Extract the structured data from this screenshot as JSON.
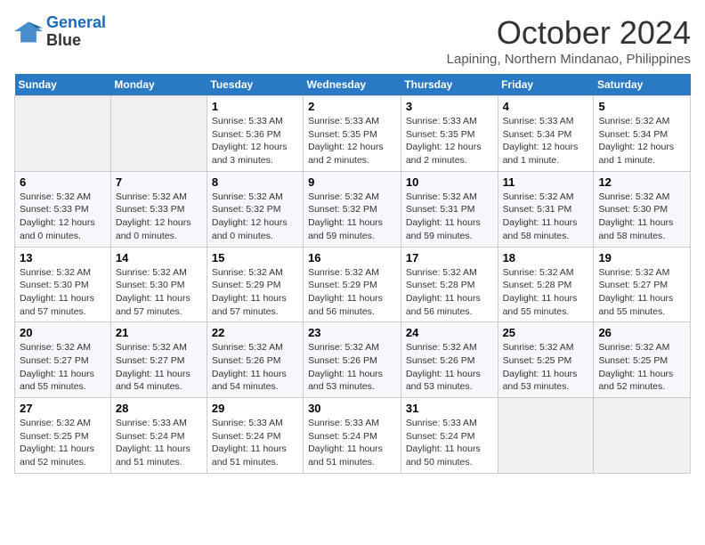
{
  "logo": {
    "line1": "General",
    "line2": "Blue"
  },
  "title": "October 2024",
  "location": "Lapining, Northern Mindanao, Philippines",
  "days_of_week": [
    "Sunday",
    "Monday",
    "Tuesday",
    "Wednesday",
    "Thursday",
    "Friday",
    "Saturday"
  ],
  "weeks": [
    [
      {
        "day": "",
        "detail": ""
      },
      {
        "day": "",
        "detail": ""
      },
      {
        "day": "1",
        "detail": "Sunrise: 5:33 AM\nSunset: 5:36 PM\nDaylight: 12 hours\nand 3 minutes."
      },
      {
        "day": "2",
        "detail": "Sunrise: 5:33 AM\nSunset: 5:35 PM\nDaylight: 12 hours\nand 2 minutes."
      },
      {
        "day": "3",
        "detail": "Sunrise: 5:33 AM\nSunset: 5:35 PM\nDaylight: 12 hours\nand 2 minutes."
      },
      {
        "day": "4",
        "detail": "Sunrise: 5:33 AM\nSunset: 5:34 PM\nDaylight: 12 hours\nand 1 minute."
      },
      {
        "day": "5",
        "detail": "Sunrise: 5:32 AM\nSunset: 5:34 PM\nDaylight: 12 hours\nand 1 minute."
      }
    ],
    [
      {
        "day": "6",
        "detail": "Sunrise: 5:32 AM\nSunset: 5:33 PM\nDaylight: 12 hours\nand 0 minutes."
      },
      {
        "day": "7",
        "detail": "Sunrise: 5:32 AM\nSunset: 5:33 PM\nDaylight: 12 hours\nand 0 minutes."
      },
      {
        "day": "8",
        "detail": "Sunrise: 5:32 AM\nSunset: 5:32 PM\nDaylight: 12 hours\nand 0 minutes."
      },
      {
        "day": "9",
        "detail": "Sunrise: 5:32 AM\nSunset: 5:32 PM\nDaylight: 11 hours\nand 59 minutes."
      },
      {
        "day": "10",
        "detail": "Sunrise: 5:32 AM\nSunset: 5:31 PM\nDaylight: 11 hours\nand 59 minutes."
      },
      {
        "day": "11",
        "detail": "Sunrise: 5:32 AM\nSunset: 5:31 PM\nDaylight: 11 hours\nand 58 minutes."
      },
      {
        "day": "12",
        "detail": "Sunrise: 5:32 AM\nSunset: 5:30 PM\nDaylight: 11 hours\nand 58 minutes."
      }
    ],
    [
      {
        "day": "13",
        "detail": "Sunrise: 5:32 AM\nSunset: 5:30 PM\nDaylight: 11 hours\nand 57 minutes."
      },
      {
        "day": "14",
        "detail": "Sunrise: 5:32 AM\nSunset: 5:30 PM\nDaylight: 11 hours\nand 57 minutes."
      },
      {
        "day": "15",
        "detail": "Sunrise: 5:32 AM\nSunset: 5:29 PM\nDaylight: 11 hours\nand 57 minutes."
      },
      {
        "day": "16",
        "detail": "Sunrise: 5:32 AM\nSunset: 5:29 PM\nDaylight: 11 hours\nand 56 minutes."
      },
      {
        "day": "17",
        "detail": "Sunrise: 5:32 AM\nSunset: 5:28 PM\nDaylight: 11 hours\nand 56 minutes."
      },
      {
        "day": "18",
        "detail": "Sunrise: 5:32 AM\nSunset: 5:28 PM\nDaylight: 11 hours\nand 55 minutes."
      },
      {
        "day": "19",
        "detail": "Sunrise: 5:32 AM\nSunset: 5:27 PM\nDaylight: 11 hours\nand 55 minutes."
      }
    ],
    [
      {
        "day": "20",
        "detail": "Sunrise: 5:32 AM\nSunset: 5:27 PM\nDaylight: 11 hours\nand 55 minutes."
      },
      {
        "day": "21",
        "detail": "Sunrise: 5:32 AM\nSunset: 5:27 PM\nDaylight: 11 hours\nand 54 minutes."
      },
      {
        "day": "22",
        "detail": "Sunrise: 5:32 AM\nSunset: 5:26 PM\nDaylight: 11 hours\nand 54 minutes."
      },
      {
        "day": "23",
        "detail": "Sunrise: 5:32 AM\nSunset: 5:26 PM\nDaylight: 11 hours\nand 53 minutes."
      },
      {
        "day": "24",
        "detail": "Sunrise: 5:32 AM\nSunset: 5:26 PM\nDaylight: 11 hours\nand 53 minutes."
      },
      {
        "day": "25",
        "detail": "Sunrise: 5:32 AM\nSunset: 5:25 PM\nDaylight: 11 hours\nand 53 minutes."
      },
      {
        "day": "26",
        "detail": "Sunrise: 5:32 AM\nSunset: 5:25 PM\nDaylight: 11 hours\nand 52 minutes."
      }
    ],
    [
      {
        "day": "27",
        "detail": "Sunrise: 5:32 AM\nSunset: 5:25 PM\nDaylight: 11 hours\nand 52 minutes."
      },
      {
        "day": "28",
        "detail": "Sunrise: 5:33 AM\nSunset: 5:24 PM\nDaylight: 11 hours\nand 51 minutes."
      },
      {
        "day": "29",
        "detail": "Sunrise: 5:33 AM\nSunset: 5:24 PM\nDaylight: 11 hours\nand 51 minutes."
      },
      {
        "day": "30",
        "detail": "Sunrise: 5:33 AM\nSunset: 5:24 PM\nDaylight: 11 hours\nand 51 minutes."
      },
      {
        "day": "31",
        "detail": "Sunrise: 5:33 AM\nSunset: 5:24 PM\nDaylight: 11 hours\nand 50 minutes."
      },
      {
        "day": "",
        "detail": ""
      },
      {
        "day": "",
        "detail": ""
      }
    ]
  ]
}
